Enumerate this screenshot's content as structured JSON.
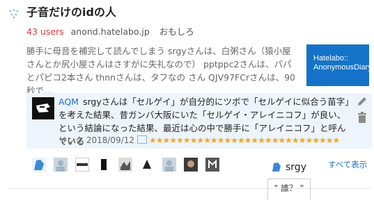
{
  "entry": {
    "title": "子音だけのidの人",
    "users": "43 users",
    "domain": "anond.hatelabo.jp",
    "category": "おもしろ",
    "summary": "勝手に母音を補完して読んでしまう srgyさんは、白粥さん（猿小屋さんとか尻小屋さんはさすがに失礼なので） pptppc2さんは、パパとパピコ2本さん thnnさんは、タフなの さん QJV97FCrさんは、90秒で…",
    "thumbnail_text": "Hatelabo::\nAnonymousDiary"
  },
  "comment": {
    "user": "AQM",
    "text": "srgyさんは「セルゲイ」が自分的にツボで「セルゲイに似合う苗字」を考えた結果、昔ガンバ大阪にいた「セルゲイ・アレイニコフ」が良い、という結論になった結果、最近は心の中で勝手に「アレイニコフ」と呼んでいる",
    "footer_prefix": "リンク",
    "date": "2018/09/12",
    "stars": "★★★★★★★★★★★★★★★★★★★★★★★★★★★★"
  },
  "stars_users": {
    "all_link": "すべて表示"
  },
  "tooltip": {
    "user": "srgy",
    "quote": "\" 誰？ \""
  },
  "colors": {
    "users": "#e0383b",
    "link": "#1a6fc4",
    "comment_bg": "#eef4fb",
    "thumbnail_bg": "#1473c9",
    "star": "#f5a623"
  }
}
